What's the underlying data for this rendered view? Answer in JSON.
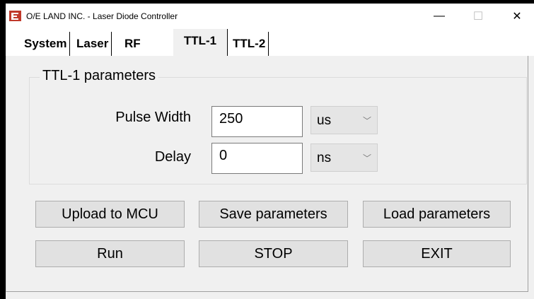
{
  "window": {
    "title": "O/E LAND INC. - Laser Diode Controller",
    "minimize_glyph": "—",
    "maximize_glyph": "☐",
    "close_glyph": "✕",
    "icon": "app-logo-icon"
  },
  "tabs": [
    {
      "label": "System"
    },
    {
      "label": "Laser"
    },
    {
      "label": "RF"
    },
    {
      "label": "TTL-1"
    },
    {
      "label": "TTL-2"
    }
  ],
  "active_tab": "TTL-1",
  "ttl1": {
    "group_title": "TTL-1 parameters",
    "pulse_width": {
      "label": "Pulse Width",
      "value": "250",
      "unit": "us"
    },
    "delay": {
      "label": "Delay",
      "value": "0",
      "unit": "ns"
    }
  },
  "buttons": {
    "upload": "Upload to MCU",
    "save": "Save parameters",
    "load": "Load parameters",
    "run": "Run",
    "stop": "STOP",
    "exit": "EXIT"
  },
  "colors": {
    "client_bg": "#f0f0f0",
    "button_bg": "#e1e1e1",
    "logo_red": "#c0392b"
  }
}
